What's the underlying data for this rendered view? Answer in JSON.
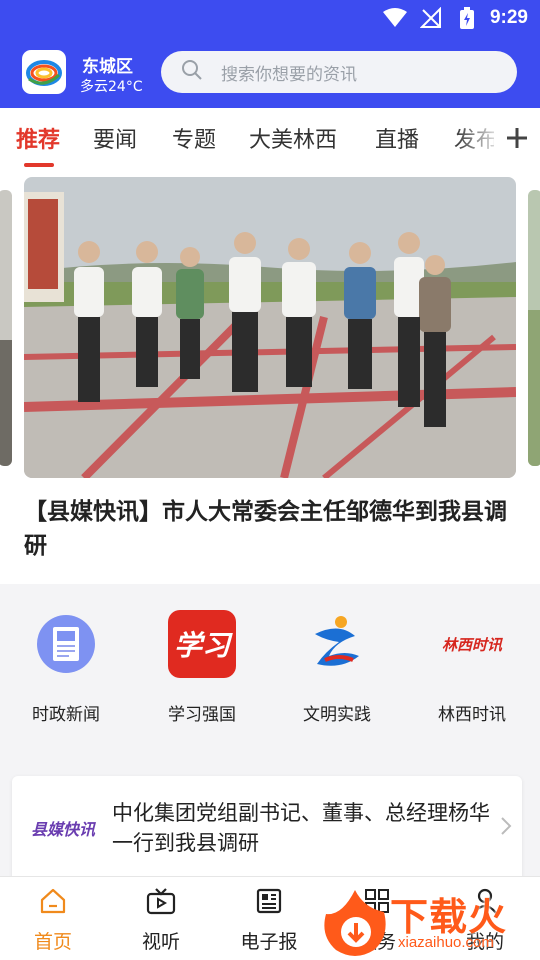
{
  "status": {
    "time": "9:29"
  },
  "header": {
    "city": "东城区",
    "weather": "多云24°C",
    "search_placeholder": "搜索你想要的资讯"
  },
  "tabs": [
    {
      "label": "推荐",
      "active": true
    },
    {
      "label": "要闻"
    },
    {
      "label": "专题"
    },
    {
      "label": "大美林西"
    },
    {
      "label": "直播"
    },
    {
      "label": "发布"
    }
  ],
  "carousel": {
    "headline": "【县媒快讯】市人大常委会主任邹德华到我县调研"
  },
  "quick_links": [
    {
      "label": "时政新闻",
      "icon": "newspaper-icon"
    },
    {
      "label": "学习强国",
      "icon": "xuexi-icon",
      "logo_text": "学习"
    },
    {
      "label": "文明实践",
      "icon": "civilization-icon"
    },
    {
      "label": "林西时讯",
      "icon": "linxi-news-icon",
      "logo_text": "林西时讯"
    }
  ],
  "news_card": {
    "logo_text": "县媒快讯",
    "title": "中化集团党组副书记、董事、总经理杨华一行到我县调研"
  },
  "bottom_nav": [
    {
      "label": "首页",
      "icon": "home-icon",
      "active": true
    },
    {
      "label": "视听",
      "icon": "tv-icon"
    },
    {
      "label": "电子报",
      "icon": "newspaper-icon"
    },
    {
      "label": "服务",
      "icon": "grid-icon"
    },
    {
      "label": "我的",
      "icon": "user-icon"
    }
  ],
  "watermark": {
    "text": "下载火",
    "url": "xiazaihuo.com"
  },
  "colors": {
    "brand_blue": "#3d4cf0",
    "accent_red": "#e2382b",
    "nav_active": "#f08a1c"
  }
}
